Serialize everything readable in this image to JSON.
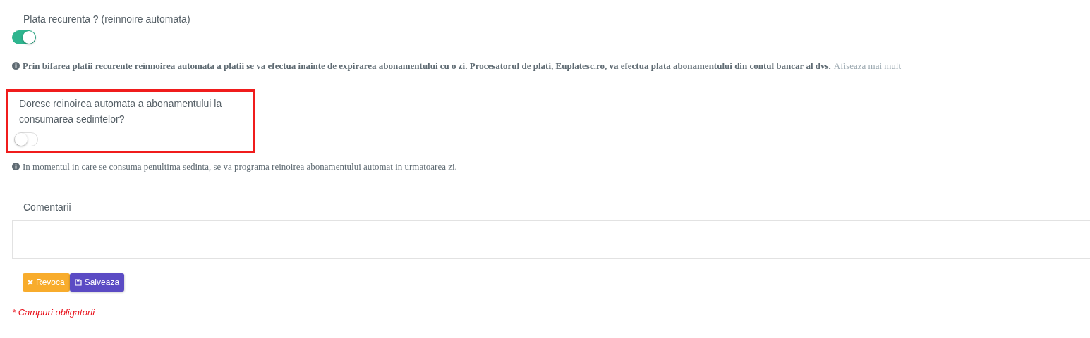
{
  "recurring": {
    "label": "Plata recurenta ? (reinnoire automata)",
    "on": true,
    "info": "Prin bifarea platii recurente reînnoirea automata a platii se va efectua inainte de expirarea abonamentului cu o zi. Procesatorul de plati, Euplatesc.ro, va efectua plata abonamentului din contul bancar al dvs.",
    "more_link": "Afiseaza mai mult"
  },
  "auto_renew": {
    "label": "Doresc reinoirea automata a abonamentului la consumarea sedintelor?",
    "on": false,
    "highlighted": true,
    "info": "In momentul in care se consuma penultima sedinta, se va programa reinoirea abonamentului automat in urmatoarea zi."
  },
  "comments": {
    "label": "Comentarii"
  },
  "buttons": [
    {
      "kind": "cancel",
      "label": "Revoca"
    },
    {
      "kind": "save",
      "label": "Salveaza"
    }
  ],
  "required_note": "* Campuri obligatorii"
}
